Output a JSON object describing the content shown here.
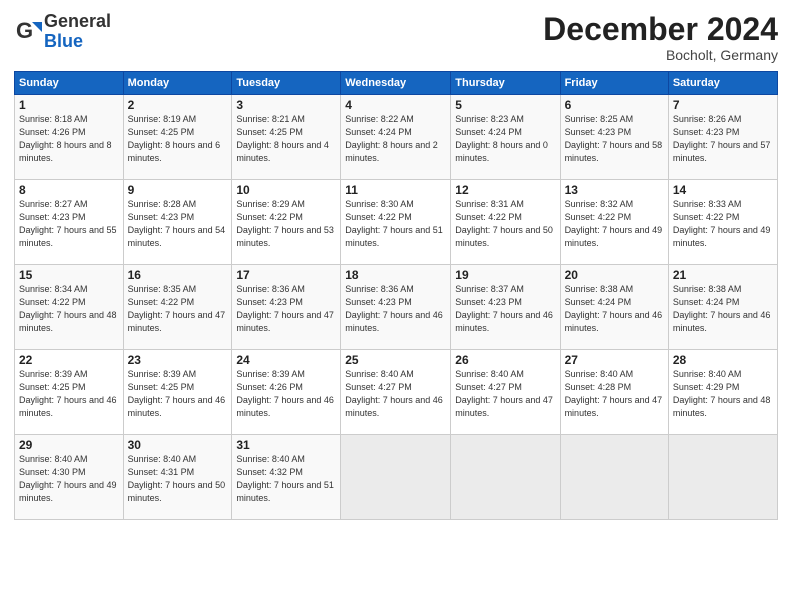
{
  "logo": {
    "general": "General",
    "blue": "Blue"
  },
  "title": "December 2024",
  "location": "Bocholt, Germany",
  "days_of_week": [
    "Sunday",
    "Monday",
    "Tuesday",
    "Wednesday",
    "Thursday",
    "Friday",
    "Saturday"
  ],
  "weeks": [
    [
      {
        "day": "1",
        "sunrise": "8:18 AM",
        "sunset": "4:26 PM",
        "daylight": "8 hours and 8 minutes."
      },
      {
        "day": "2",
        "sunrise": "8:19 AM",
        "sunset": "4:25 PM",
        "daylight": "8 hours and 6 minutes."
      },
      {
        "day": "3",
        "sunrise": "8:21 AM",
        "sunset": "4:25 PM",
        "daylight": "8 hours and 4 minutes."
      },
      {
        "day": "4",
        "sunrise": "8:22 AM",
        "sunset": "4:24 PM",
        "daylight": "8 hours and 2 minutes."
      },
      {
        "day": "5",
        "sunrise": "8:23 AM",
        "sunset": "4:24 PM",
        "daylight": "8 hours and 0 minutes."
      },
      {
        "day": "6",
        "sunrise": "8:25 AM",
        "sunset": "4:23 PM",
        "daylight": "7 hours and 58 minutes."
      },
      {
        "day": "7",
        "sunrise": "8:26 AM",
        "sunset": "4:23 PM",
        "daylight": "7 hours and 57 minutes."
      }
    ],
    [
      {
        "day": "8",
        "sunrise": "8:27 AM",
        "sunset": "4:23 PM",
        "daylight": "7 hours and 55 minutes."
      },
      {
        "day": "9",
        "sunrise": "8:28 AM",
        "sunset": "4:23 PM",
        "daylight": "7 hours and 54 minutes."
      },
      {
        "day": "10",
        "sunrise": "8:29 AM",
        "sunset": "4:22 PM",
        "daylight": "7 hours and 53 minutes."
      },
      {
        "day": "11",
        "sunrise": "8:30 AM",
        "sunset": "4:22 PM",
        "daylight": "7 hours and 51 minutes."
      },
      {
        "day": "12",
        "sunrise": "8:31 AM",
        "sunset": "4:22 PM",
        "daylight": "7 hours and 50 minutes."
      },
      {
        "day": "13",
        "sunrise": "8:32 AM",
        "sunset": "4:22 PM",
        "daylight": "7 hours and 49 minutes."
      },
      {
        "day": "14",
        "sunrise": "8:33 AM",
        "sunset": "4:22 PM",
        "daylight": "7 hours and 49 minutes."
      }
    ],
    [
      {
        "day": "15",
        "sunrise": "8:34 AM",
        "sunset": "4:22 PM",
        "daylight": "7 hours and 48 minutes."
      },
      {
        "day": "16",
        "sunrise": "8:35 AM",
        "sunset": "4:22 PM",
        "daylight": "7 hours and 47 minutes."
      },
      {
        "day": "17",
        "sunrise": "8:36 AM",
        "sunset": "4:23 PM",
        "daylight": "7 hours and 47 minutes."
      },
      {
        "day": "18",
        "sunrise": "8:36 AM",
        "sunset": "4:23 PM",
        "daylight": "7 hours and 46 minutes."
      },
      {
        "day": "19",
        "sunrise": "8:37 AM",
        "sunset": "4:23 PM",
        "daylight": "7 hours and 46 minutes."
      },
      {
        "day": "20",
        "sunrise": "8:38 AM",
        "sunset": "4:24 PM",
        "daylight": "7 hours and 46 minutes."
      },
      {
        "day": "21",
        "sunrise": "8:38 AM",
        "sunset": "4:24 PM",
        "daylight": "7 hours and 46 minutes."
      }
    ],
    [
      {
        "day": "22",
        "sunrise": "8:39 AM",
        "sunset": "4:25 PM",
        "daylight": "7 hours and 46 minutes."
      },
      {
        "day": "23",
        "sunrise": "8:39 AM",
        "sunset": "4:25 PM",
        "daylight": "7 hours and 46 minutes."
      },
      {
        "day": "24",
        "sunrise": "8:39 AM",
        "sunset": "4:26 PM",
        "daylight": "7 hours and 46 minutes."
      },
      {
        "day": "25",
        "sunrise": "8:40 AM",
        "sunset": "4:27 PM",
        "daylight": "7 hours and 46 minutes."
      },
      {
        "day": "26",
        "sunrise": "8:40 AM",
        "sunset": "4:27 PM",
        "daylight": "7 hours and 47 minutes."
      },
      {
        "day": "27",
        "sunrise": "8:40 AM",
        "sunset": "4:28 PM",
        "daylight": "7 hours and 47 minutes."
      },
      {
        "day": "28",
        "sunrise": "8:40 AM",
        "sunset": "4:29 PM",
        "daylight": "7 hours and 48 minutes."
      }
    ],
    [
      {
        "day": "29",
        "sunrise": "8:40 AM",
        "sunset": "4:30 PM",
        "daylight": "7 hours and 49 minutes."
      },
      {
        "day": "30",
        "sunrise": "8:40 AM",
        "sunset": "4:31 PM",
        "daylight": "7 hours and 50 minutes."
      },
      {
        "day": "31",
        "sunrise": "8:40 AM",
        "sunset": "4:32 PM",
        "daylight": "7 hours and 51 minutes."
      },
      null,
      null,
      null,
      null
    ]
  ]
}
